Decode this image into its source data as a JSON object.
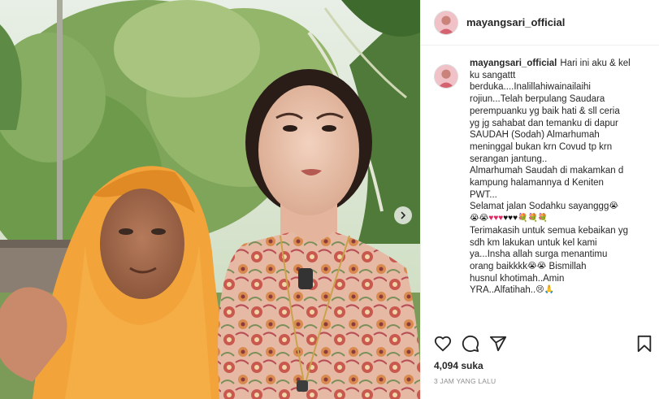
{
  "post": {
    "username": "mayangsari_official",
    "caption_lines": [
      "Hari ini aku & kel",
      "ku sangattt",
      "berduka....Inalillahiwainailaihi",
      "rojiun...Telah berpulang Saudara",
      "perempuanku yg baik hati & sll ceria",
      "yg jg sahabat dan temanku di dapur",
      "SAUDAH (Sodah) Almarhumah",
      "meninggal bukan krn Covud tp krn",
      "serangan jantung..",
      "Almarhumah Saudah di makamkan d",
      "kampung halamannya d Keniten",
      "PWT...",
      "Selamat jalan Sodahku sayanggg",
      "Terimakasih untuk semua kebaikan yg",
      "sdh km lakukan untuk kel kami",
      "ya...Insha allah surga menantimu",
      "orang baikkkk",
      "Bismillah",
      "husnul khotimah..Amin",
      "YRA..Alfatihah.."
    ],
    "likes_text": "4,094 suka",
    "time_text": "3 JAM YANG LALU"
  },
  "icons": {
    "heart": "heart-icon",
    "comment": "comment-icon",
    "share": "share-icon",
    "save": "bookmark-icon",
    "next": "chevron-right-icon"
  },
  "colors": {
    "text": "#262626",
    "muted": "#8e8e8e",
    "border": "#efefef",
    "hijab": "#f2a33a"
  }
}
